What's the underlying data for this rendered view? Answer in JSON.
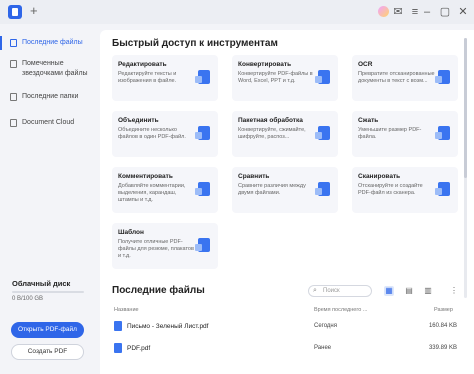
{
  "titlebar": {
    "new_tab": "+",
    "icons": [
      "avatar",
      "gift-icon",
      "message-icon",
      "menu-icon",
      "minimize-icon",
      "maximize-icon",
      "close-icon"
    ]
  },
  "sidebar": {
    "items": [
      {
        "label": "Последние файлы",
        "active": true
      },
      {
        "label": "Помеченные звездочками файлы",
        "active": false
      },
      {
        "label": "Последние папки",
        "active": false
      },
      {
        "label": "Document Cloud",
        "active": false
      }
    ],
    "disk_title": "Облачный диск",
    "disk_usage": "0 B/100 GB",
    "disk_used_fraction": 0,
    "open_button": "Открыть PDF-файл",
    "create_button": "Создать PDF"
  },
  "quick": {
    "title": "Быстрый доступ к инструментам",
    "cards": [
      {
        "title": "Редактировать",
        "desc": "Редактируйте тексты и изображения в файле."
      },
      {
        "title": "Конвертировать",
        "desc": "Конвертируйте PDF-файлы в Word, Excel, PPT и т.д."
      },
      {
        "title": "OCR",
        "desc": "Превратите отсканированные документы в текст с возм..."
      },
      {
        "title": "Объединить",
        "desc": "Объедините несколько файлов в один PDF-файл."
      },
      {
        "title": "Пакетная обработка",
        "desc": "Конвертируйте, сжимайте, шифруйте, распоз..."
      },
      {
        "title": "Сжать",
        "desc": "Уменьшите размер PDF-файла."
      },
      {
        "title": "Комментировать",
        "desc": "Добавляйте комментарии, выделения, карандаш, штампы и т.д."
      },
      {
        "title": "Сравнить",
        "desc": "Сравните различия между двумя файлами."
      },
      {
        "title": "Сканировать",
        "desc": "Отсканируйте и создайте PDF-файл из сканера."
      },
      {
        "title": "Шаблон",
        "desc": "Получите отличные PDF-файлы для резюме, плакатов и т.д."
      }
    ]
  },
  "recent": {
    "title": "Последние файлы",
    "search_placeholder": "Поиск",
    "columns": {
      "name": "Название",
      "time": "Время последнего ...",
      "size": "Размер"
    },
    "rows": [
      {
        "name": "Письмо - Зеленый Лист.pdf",
        "time": "Сегодня",
        "size": "160.84 KB"
      },
      {
        "name": "PDF.pdf",
        "time": "Ранее",
        "size": "339.89 KB"
      }
    ]
  }
}
